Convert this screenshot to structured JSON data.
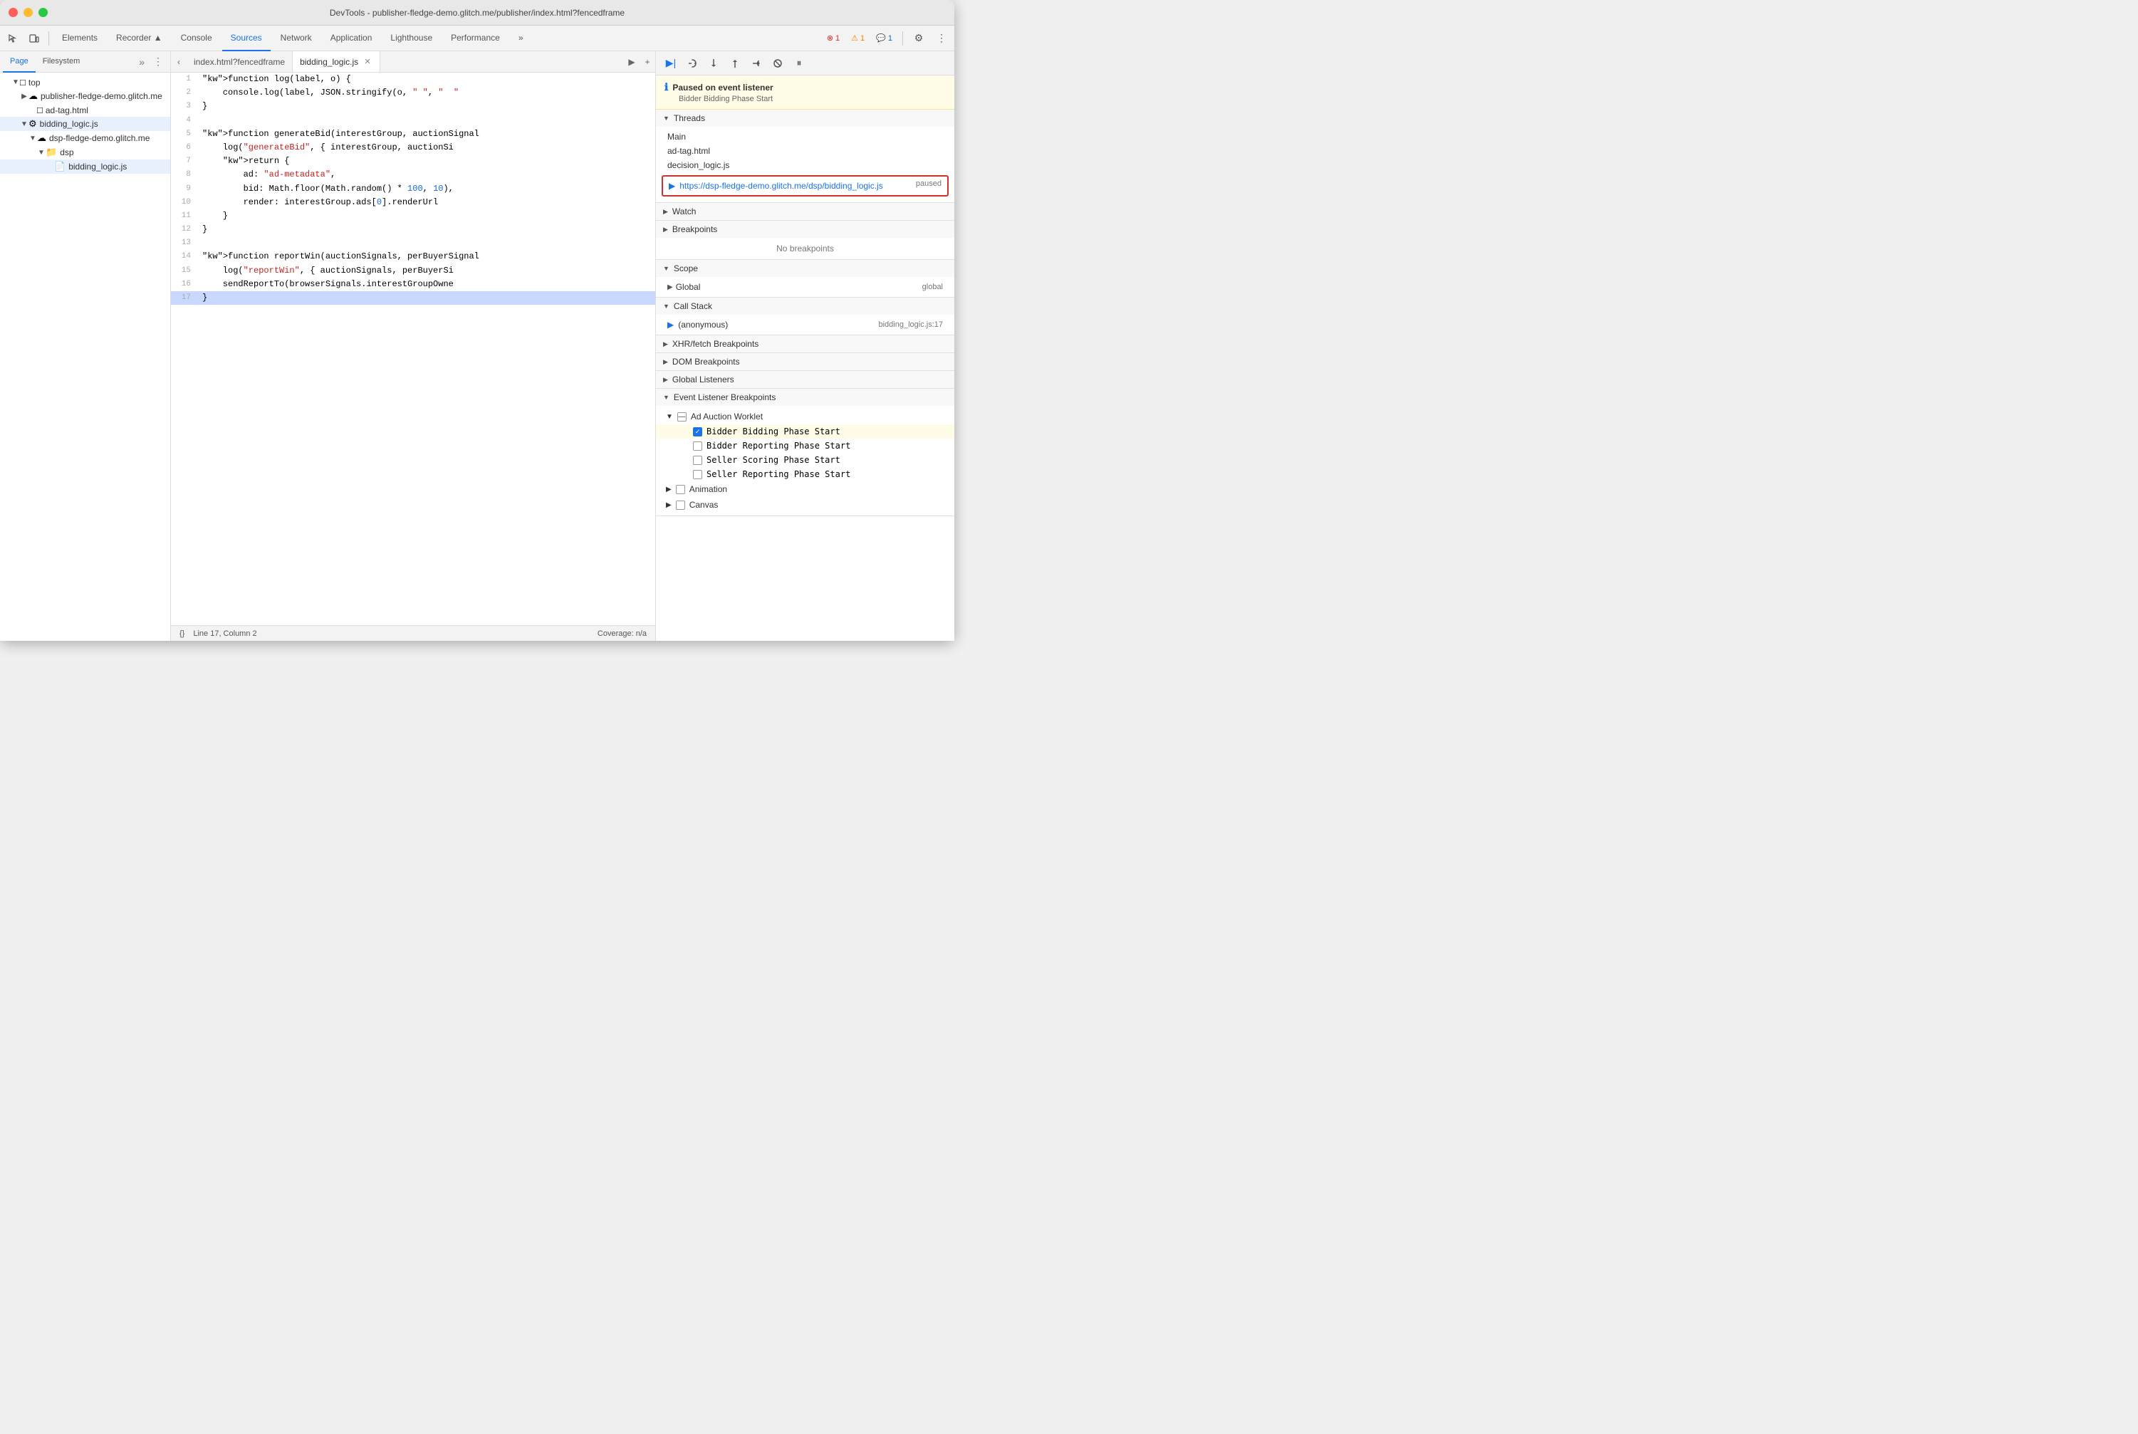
{
  "titleBar": {
    "title": "DevTools - publisher-fledge-demo.glitch.me/publisher/index.html?fencedframe"
  },
  "toolbar": {
    "tabs": [
      {
        "id": "elements",
        "label": "Elements",
        "active": false
      },
      {
        "id": "recorder",
        "label": "Recorder ▲",
        "active": false
      },
      {
        "id": "console",
        "label": "Console",
        "active": false
      },
      {
        "id": "sources",
        "label": "Sources",
        "active": true
      },
      {
        "id": "network",
        "label": "Network",
        "active": false
      },
      {
        "id": "application",
        "label": "Application",
        "active": false
      },
      {
        "id": "lighthouse",
        "label": "Lighthouse",
        "active": false
      },
      {
        "id": "performance",
        "label": "Performance",
        "active": false
      }
    ],
    "moreTabsLabel": "»",
    "errorCount": "1",
    "warningCount": "1",
    "messageCount": "1"
  },
  "leftPanel": {
    "tabs": [
      {
        "id": "page",
        "label": "Page",
        "active": true
      },
      {
        "id": "filesystem",
        "label": "Filesystem",
        "active": false
      }
    ],
    "moreLabel": "»",
    "tree": [
      {
        "id": "top",
        "indent": 0,
        "arrow": "▼",
        "icon": "□",
        "label": "top",
        "type": "frame"
      },
      {
        "id": "publisher",
        "indent": 1,
        "arrow": "▶",
        "icon": "☁",
        "label": "publisher-fledge-demo.glitch.me",
        "type": "origin"
      },
      {
        "id": "ad-tag",
        "indent": 2,
        "arrow": "",
        "icon": "□",
        "label": "ad-tag.html",
        "type": "file"
      },
      {
        "id": "bidding-logic",
        "indent": 1,
        "arrow": "▼",
        "icon": "⚙",
        "label": "bidding_logic.js",
        "type": "worklet",
        "selected": true
      },
      {
        "id": "dsp-origin",
        "indent": 2,
        "arrow": "▼",
        "icon": "☁",
        "label": "dsp-fledge-demo.glitch.me",
        "type": "origin"
      },
      {
        "id": "dsp-folder",
        "indent": 3,
        "arrow": "▼",
        "icon": "📁",
        "label": "dsp",
        "type": "folder"
      },
      {
        "id": "bidding-logic-file",
        "indent": 4,
        "arrow": "",
        "icon": "📄",
        "label": "bidding_logic.js",
        "type": "file",
        "selected": true
      }
    ]
  },
  "editorTabs": [
    {
      "id": "index",
      "label": "index.html?fencedframe",
      "active": false,
      "closeable": false
    },
    {
      "id": "bidding",
      "label": "bidding_logic.js",
      "active": true,
      "closeable": true
    }
  ],
  "code": {
    "lines": [
      {
        "num": 1,
        "content": "function log(label, o) {",
        "highlighted": false
      },
      {
        "num": 2,
        "content": "    console.log(label, JSON.stringify(o, \" \", \"  \"",
        "highlighted": false
      },
      {
        "num": 3,
        "content": "}",
        "highlighted": false
      },
      {
        "num": 4,
        "content": "",
        "highlighted": false
      },
      {
        "num": 5,
        "content": "function generateBid(interestGroup, auctionSignal",
        "highlighted": false
      },
      {
        "num": 6,
        "content": "    log(\"generateBid\", { interestGroup, auctionSi",
        "highlighted": false
      },
      {
        "num": 7,
        "content": "    return {",
        "highlighted": false
      },
      {
        "num": 8,
        "content": "        ad: \"ad-metadata\",",
        "highlighted": false
      },
      {
        "num": 9,
        "content": "        bid: Math.floor(Math.random() * 100, 10),",
        "highlighted": false
      },
      {
        "num": 10,
        "content": "        render: interestGroup.ads[0].renderUrl",
        "highlighted": false
      },
      {
        "num": 11,
        "content": "    }",
        "highlighted": false
      },
      {
        "num": 12,
        "content": "}",
        "highlighted": false
      },
      {
        "num": 13,
        "content": "",
        "highlighted": false
      },
      {
        "num": 14,
        "content": "function reportWin(auctionSignals, perBuyerSignal",
        "highlighted": false
      },
      {
        "num": 15,
        "content": "    log(\"reportWin\", { auctionSignals, perBuyerSi",
        "highlighted": false
      },
      {
        "num": 16,
        "content": "    sendReportTo(browserSignals.interestGroupOwne",
        "highlighted": false
      },
      {
        "num": 17,
        "content": "}",
        "highlighted": true
      }
    ]
  },
  "statusBar": {
    "formatBtn": "{}",
    "position": "Line 17, Column 2",
    "coverage": "Coverage: n/a"
  },
  "rightPanel": {
    "debuggerBtns": [
      {
        "id": "resume",
        "icon": "▶",
        "title": "Resume",
        "active": true
      },
      {
        "id": "step-over",
        "icon": "↷",
        "title": "Step over"
      },
      {
        "id": "step-into",
        "icon": "↓",
        "title": "Step into"
      },
      {
        "id": "step-out",
        "icon": "↑",
        "title": "Step out"
      },
      {
        "id": "step",
        "icon": "→",
        "title": "Step"
      },
      {
        "id": "deactivate",
        "icon": "⊘",
        "title": "Deactivate breakpoints"
      },
      {
        "id": "pause-exceptions",
        "icon": "⏸",
        "title": "Pause on exceptions"
      }
    ],
    "pausedBanner": {
      "title": "Paused on event listener",
      "subtitle": "Bidder Bidding Phase Start"
    },
    "sections": {
      "threads": {
        "label": "Threads",
        "items": [
          {
            "id": "main",
            "label": "Main",
            "active": false
          },
          {
            "id": "ad-tag",
            "label": "ad-tag.html",
            "active": false
          },
          {
            "id": "decision-logic",
            "label": "decision_logic.js",
            "active": false
          },
          {
            "id": "bidding-logic-thread",
            "label": "https://dsp-fledge-demo.glitch.me/dsp/bidding_logic.js",
            "status": "paused",
            "active": true
          }
        ]
      },
      "watch": {
        "label": "Watch"
      },
      "breakpoints": {
        "label": "Breakpoints",
        "empty": "No breakpoints"
      },
      "scope": {
        "label": "Scope",
        "items": [
          {
            "id": "global",
            "label": "Global",
            "value": "global"
          }
        ]
      },
      "callStack": {
        "label": "Call Stack",
        "items": [
          {
            "id": "anon",
            "label": "(anonymous)",
            "location": "bidding_logic.js:17"
          }
        ]
      },
      "xhrBreakpoints": {
        "label": "XHR/fetch Breakpoints"
      },
      "domBreakpoints": {
        "label": "DOM Breakpoints"
      },
      "globalListeners": {
        "label": "Global Listeners"
      },
      "eventListenerBreakpoints": {
        "label": "Event Listener Breakpoints",
        "subSections": [
          {
            "id": "ad-auction-worklet",
            "label": "Ad Auction Worklet",
            "items": [
              {
                "id": "bidder-bidding",
                "label": "Bidder Bidding Phase Start",
                "checked": true,
                "highlighted": true
              },
              {
                "id": "bidder-reporting",
                "label": "Bidder Reporting Phase Start",
                "checked": false
              },
              {
                "id": "seller-scoring",
                "label": "Seller Scoring Phase Start",
                "checked": false
              },
              {
                "id": "seller-reporting",
                "label": "Seller Reporting Phase Start",
                "checked": false
              }
            ]
          },
          {
            "id": "animation",
            "label": "Animation",
            "items": []
          },
          {
            "id": "canvas",
            "label": "Canvas",
            "items": []
          }
        ]
      }
    }
  }
}
